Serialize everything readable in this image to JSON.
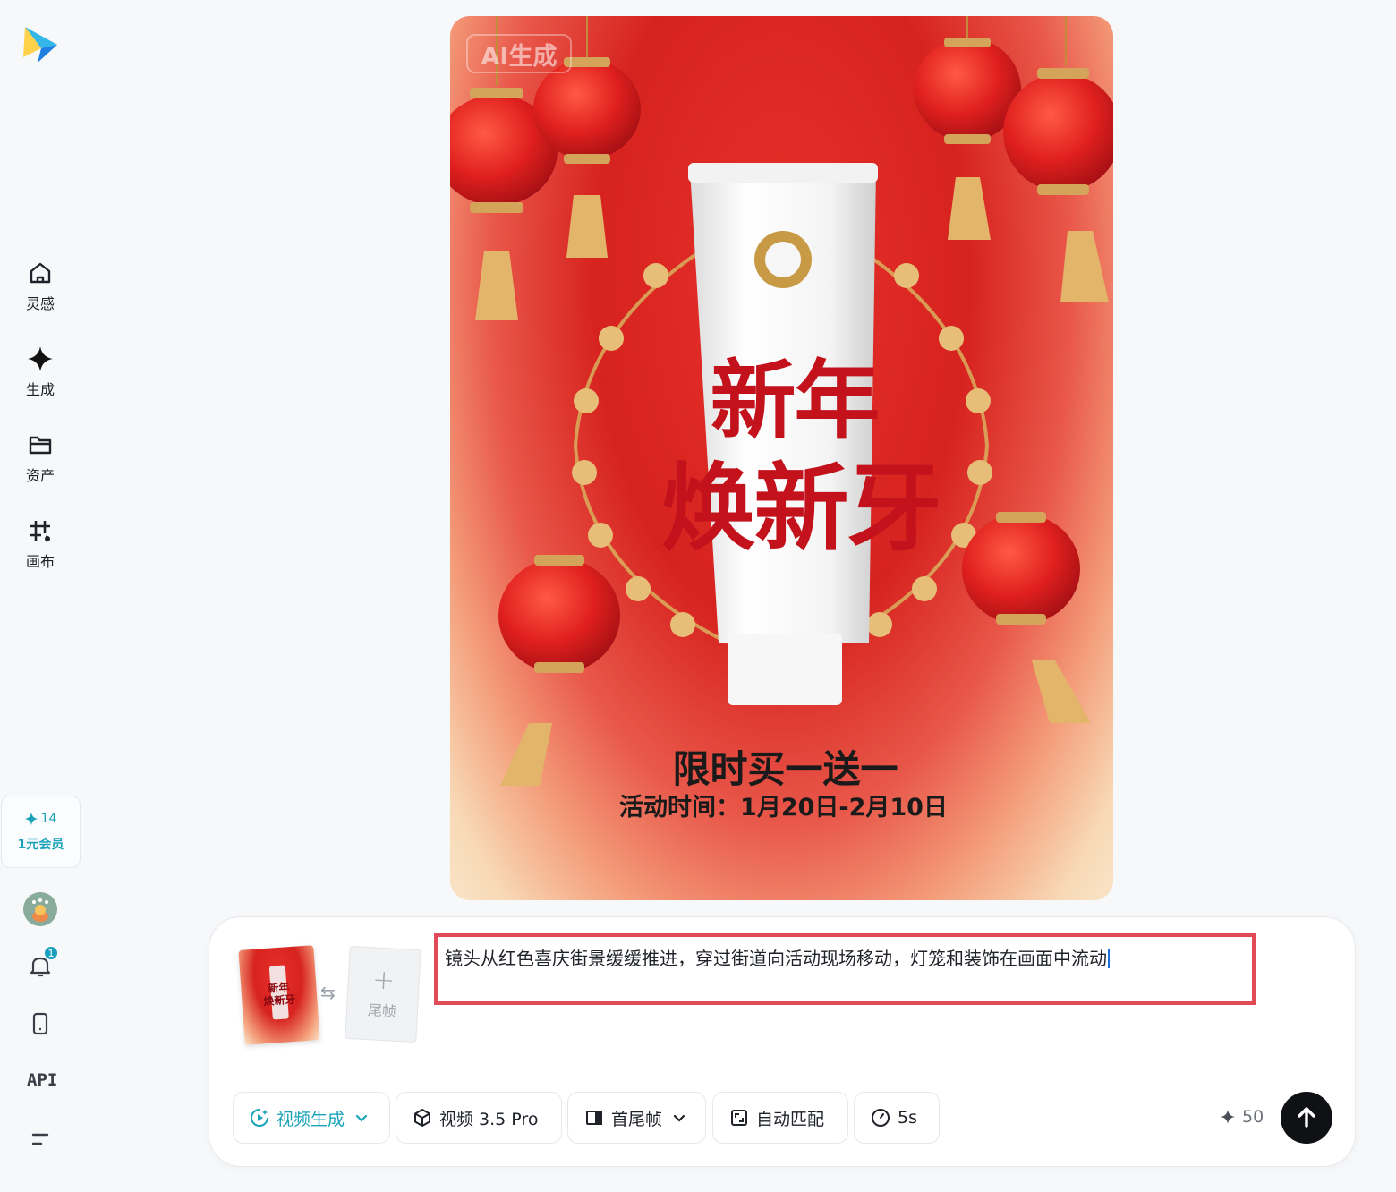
{
  "sidebar": {
    "nav": [
      {
        "label": "灵感",
        "icon": "home-icon"
      },
      {
        "label": "生成",
        "icon": "sparkle-icon"
      },
      {
        "label": "资产",
        "icon": "folder-icon"
      },
      {
        "label": "画布",
        "icon": "canvas-icon"
      }
    ],
    "credits": "14",
    "membership": "1元会员",
    "notification_count": "1",
    "api_label": "API"
  },
  "poster": {
    "ai_tag": "AI生成",
    "headline_line1": "新年",
    "headline_line2": "焕新牙",
    "promo": "限时买一送一",
    "promo_date": "活动时间：1月20日-2月10日"
  },
  "composer": {
    "first_frame_thumb": {
      "line1": "新年",
      "line2": "焕新牙"
    },
    "last_frame_label": "尾帧",
    "prompt": "镜头从红色喜庆街景缓缓推进，穿过街道向活动现场移动，灯笼和装饰在画面中流动",
    "toolbar": {
      "mode": "视频生成",
      "model": "视频 3.5 Pro",
      "frames": "首尾帧",
      "ratio": "自动匹配",
      "duration": "5s"
    },
    "cost": "50"
  },
  "colors": {
    "accent": "#1aa3b8",
    "highlight_border": "#e14a57",
    "send_button": "#0f1114"
  }
}
